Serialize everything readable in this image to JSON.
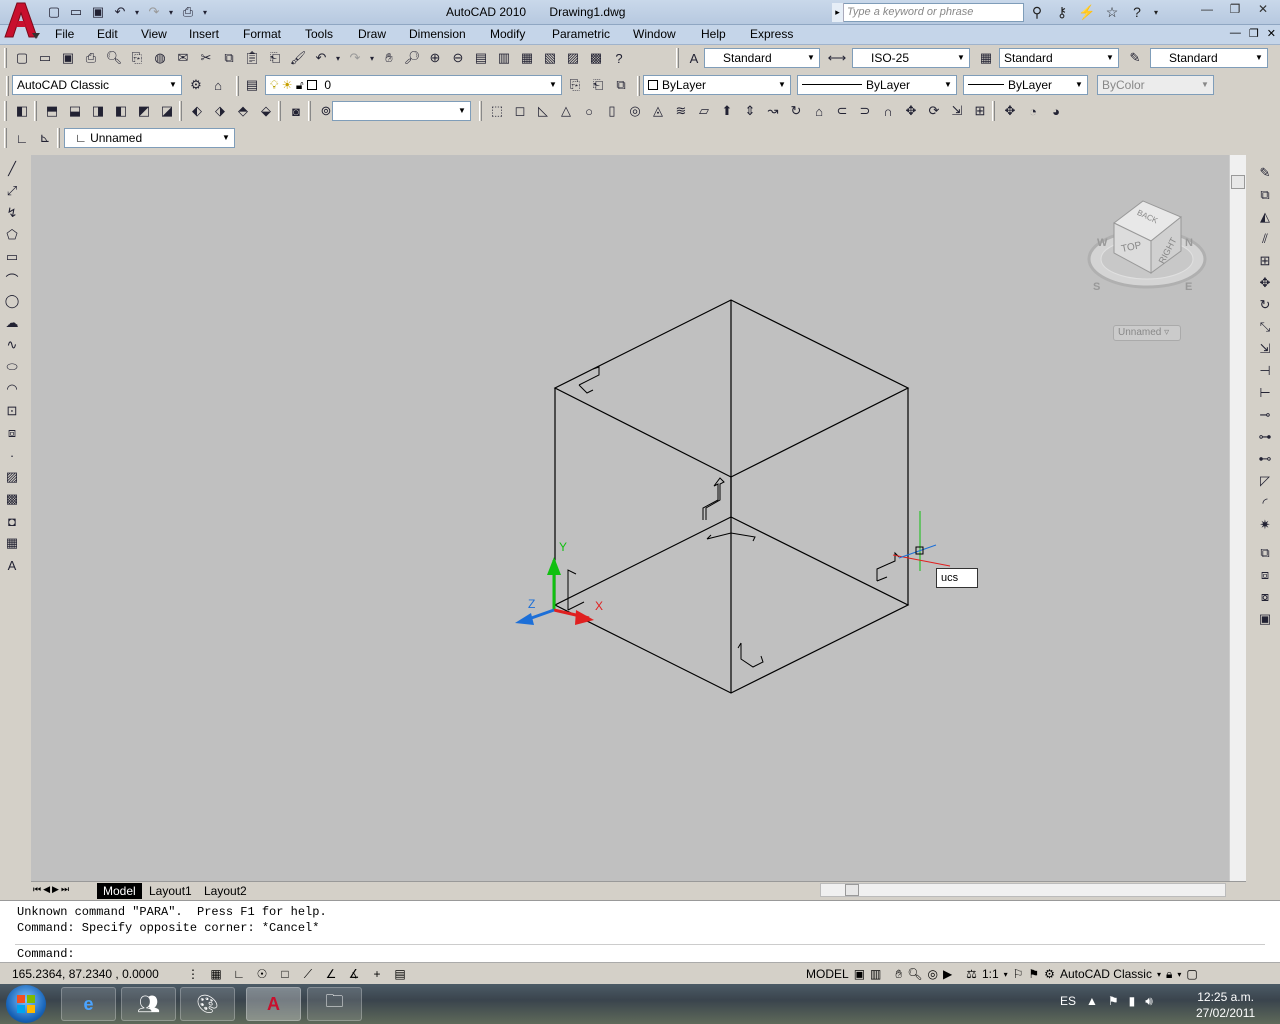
{
  "window": {
    "app_title": "AutoCAD 2010",
    "doc_title": "Drawing1.dwg",
    "search_placeholder": "Type a keyword or phrase"
  },
  "menu": [
    "File",
    "Edit",
    "View",
    "Insert",
    "Format",
    "Tools",
    "Draw",
    "Dimension",
    "Modify",
    "Parametric",
    "Window",
    "Help",
    "Express"
  ],
  "styles_toolbar": {
    "text_style": "Standard",
    "dim_style": "ISO-25",
    "table_style": "Standard",
    "mleader_style": "Standard"
  },
  "workspace": "AutoCAD Classic",
  "layer": "0",
  "properties": {
    "color": "ByLayer",
    "linetype": "ByLayer",
    "lineweight": "ByLayer",
    "plotstyle": "ByColor"
  },
  "ucs_combo": "Unnamed",
  "viewcube": {
    "face_top": "TOP",
    "face_right": "RIGHT",
    "face_back": "BACK",
    "compass_n": "N",
    "compass_e": "E",
    "compass_s": "S",
    "compass_w": "W",
    "ucs_menu": "Unnamed"
  },
  "ucs_icon": {
    "x": "X",
    "y": "Y",
    "z": "Z"
  },
  "cursor_tooltip": "ucs",
  "layout_tabs": [
    "Model",
    "Layout1",
    "Layout2"
  ],
  "command_history": [
    "Unknown command \"PARA\".  Press F1 for help.",
    "Command: Specify opposite corner: *Cancel*"
  ],
  "command_prompt": "Command:",
  "status": {
    "coordinates": "165.2364, 87.2340 , 0.0000",
    "model": "MODEL",
    "annotation_scale": "1:1",
    "workspace_label": "AutoCAD Classic"
  },
  "taskbar": {
    "language": "ES",
    "time": "12:25 a.m.",
    "date": "27/02/2011"
  },
  "colors": {
    "canvas": "#c0c0c0",
    "ucs_x": "#e02020",
    "ucs_y": "#10c010",
    "ucs_z": "#1c6fd8",
    "autocad_red": "#c8102e"
  }
}
